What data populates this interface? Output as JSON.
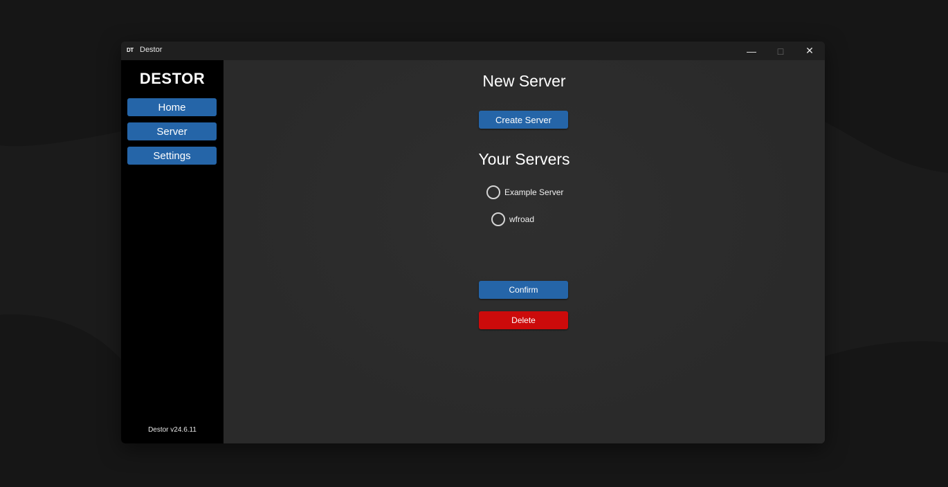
{
  "window": {
    "title": "Destor",
    "icon_text": "DT",
    "controls": {
      "minimize": "—",
      "maximize": "□",
      "close": "✕"
    }
  },
  "sidebar": {
    "brand": "DESTOR",
    "items": [
      {
        "label": "Home"
      },
      {
        "label": "Server"
      },
      {
        "label": "Settings"
      }
    ],
    "version": "Destor v24.6.11"
  },
  "main": {
    "new_server_heading": "New Server",
    "create_button": "Create Server",
    "servers_heading": "Your Servers",
    "servers": [
      {
        "label": "Example Server",
        "selected": false
      },
      {
        "label": "wfroad",
        "selected": false
      }
    ],
    "confirm_button": "Confirm",
    "delete_button": "Delete"
  },
  "colors": {
    "accent": "#2565a8",
    "danger": "#cc0b0b",
    "sidebar_bg": "#000000",
    "content_bg": "#2b2b2b"
  }
}
